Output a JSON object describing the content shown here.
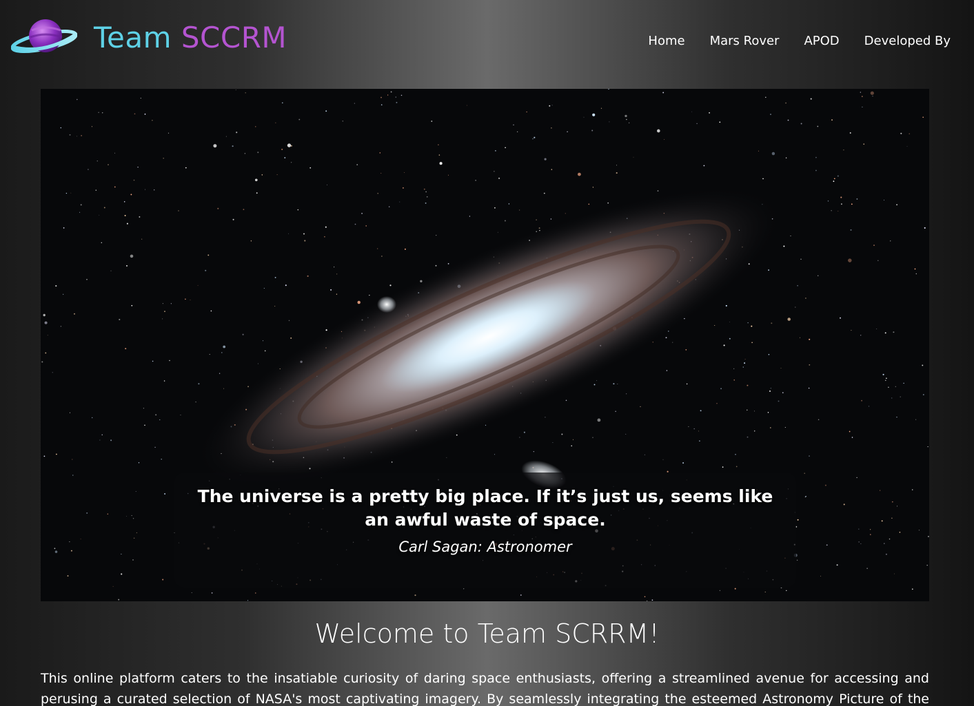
{
  "brand": {
    "word1": "Team",
    "word2": "SCCRM",
    "colors": {
      "word1": "#5ed1e6",
      "word2": "#b454d0"
    },
    "logo_icon": "planet-icon"
  },
  "nav": {
    "items": [
      {
        "label": "Home"
      },
      {
        "label": "Mars Rover"
      },
      {
        "label": "APOD"
      },
      {
        "label": "Developed By"
      }
    ]
  },
  "hero": {
    "image": "andromeda-galaxy",
    "quote": "The universe is a pretty big place. If it’s just us, seems like an awful waste of space.",
    "author": "Carl Sagan: Astronomer"
  },
  "welcome": {
    "title": "Welcome to Team SCRRM!",
    "text": "This online platform caters to the insatiable curiosity of daring space enthusiasts, offering a streamlined avenue for accessing and perusing a curated selection of NASA's most captivating imagery. By seamlessly integrating the esteemed Astronomy Picture of the Day (APOD) and Mars"
  }
}
